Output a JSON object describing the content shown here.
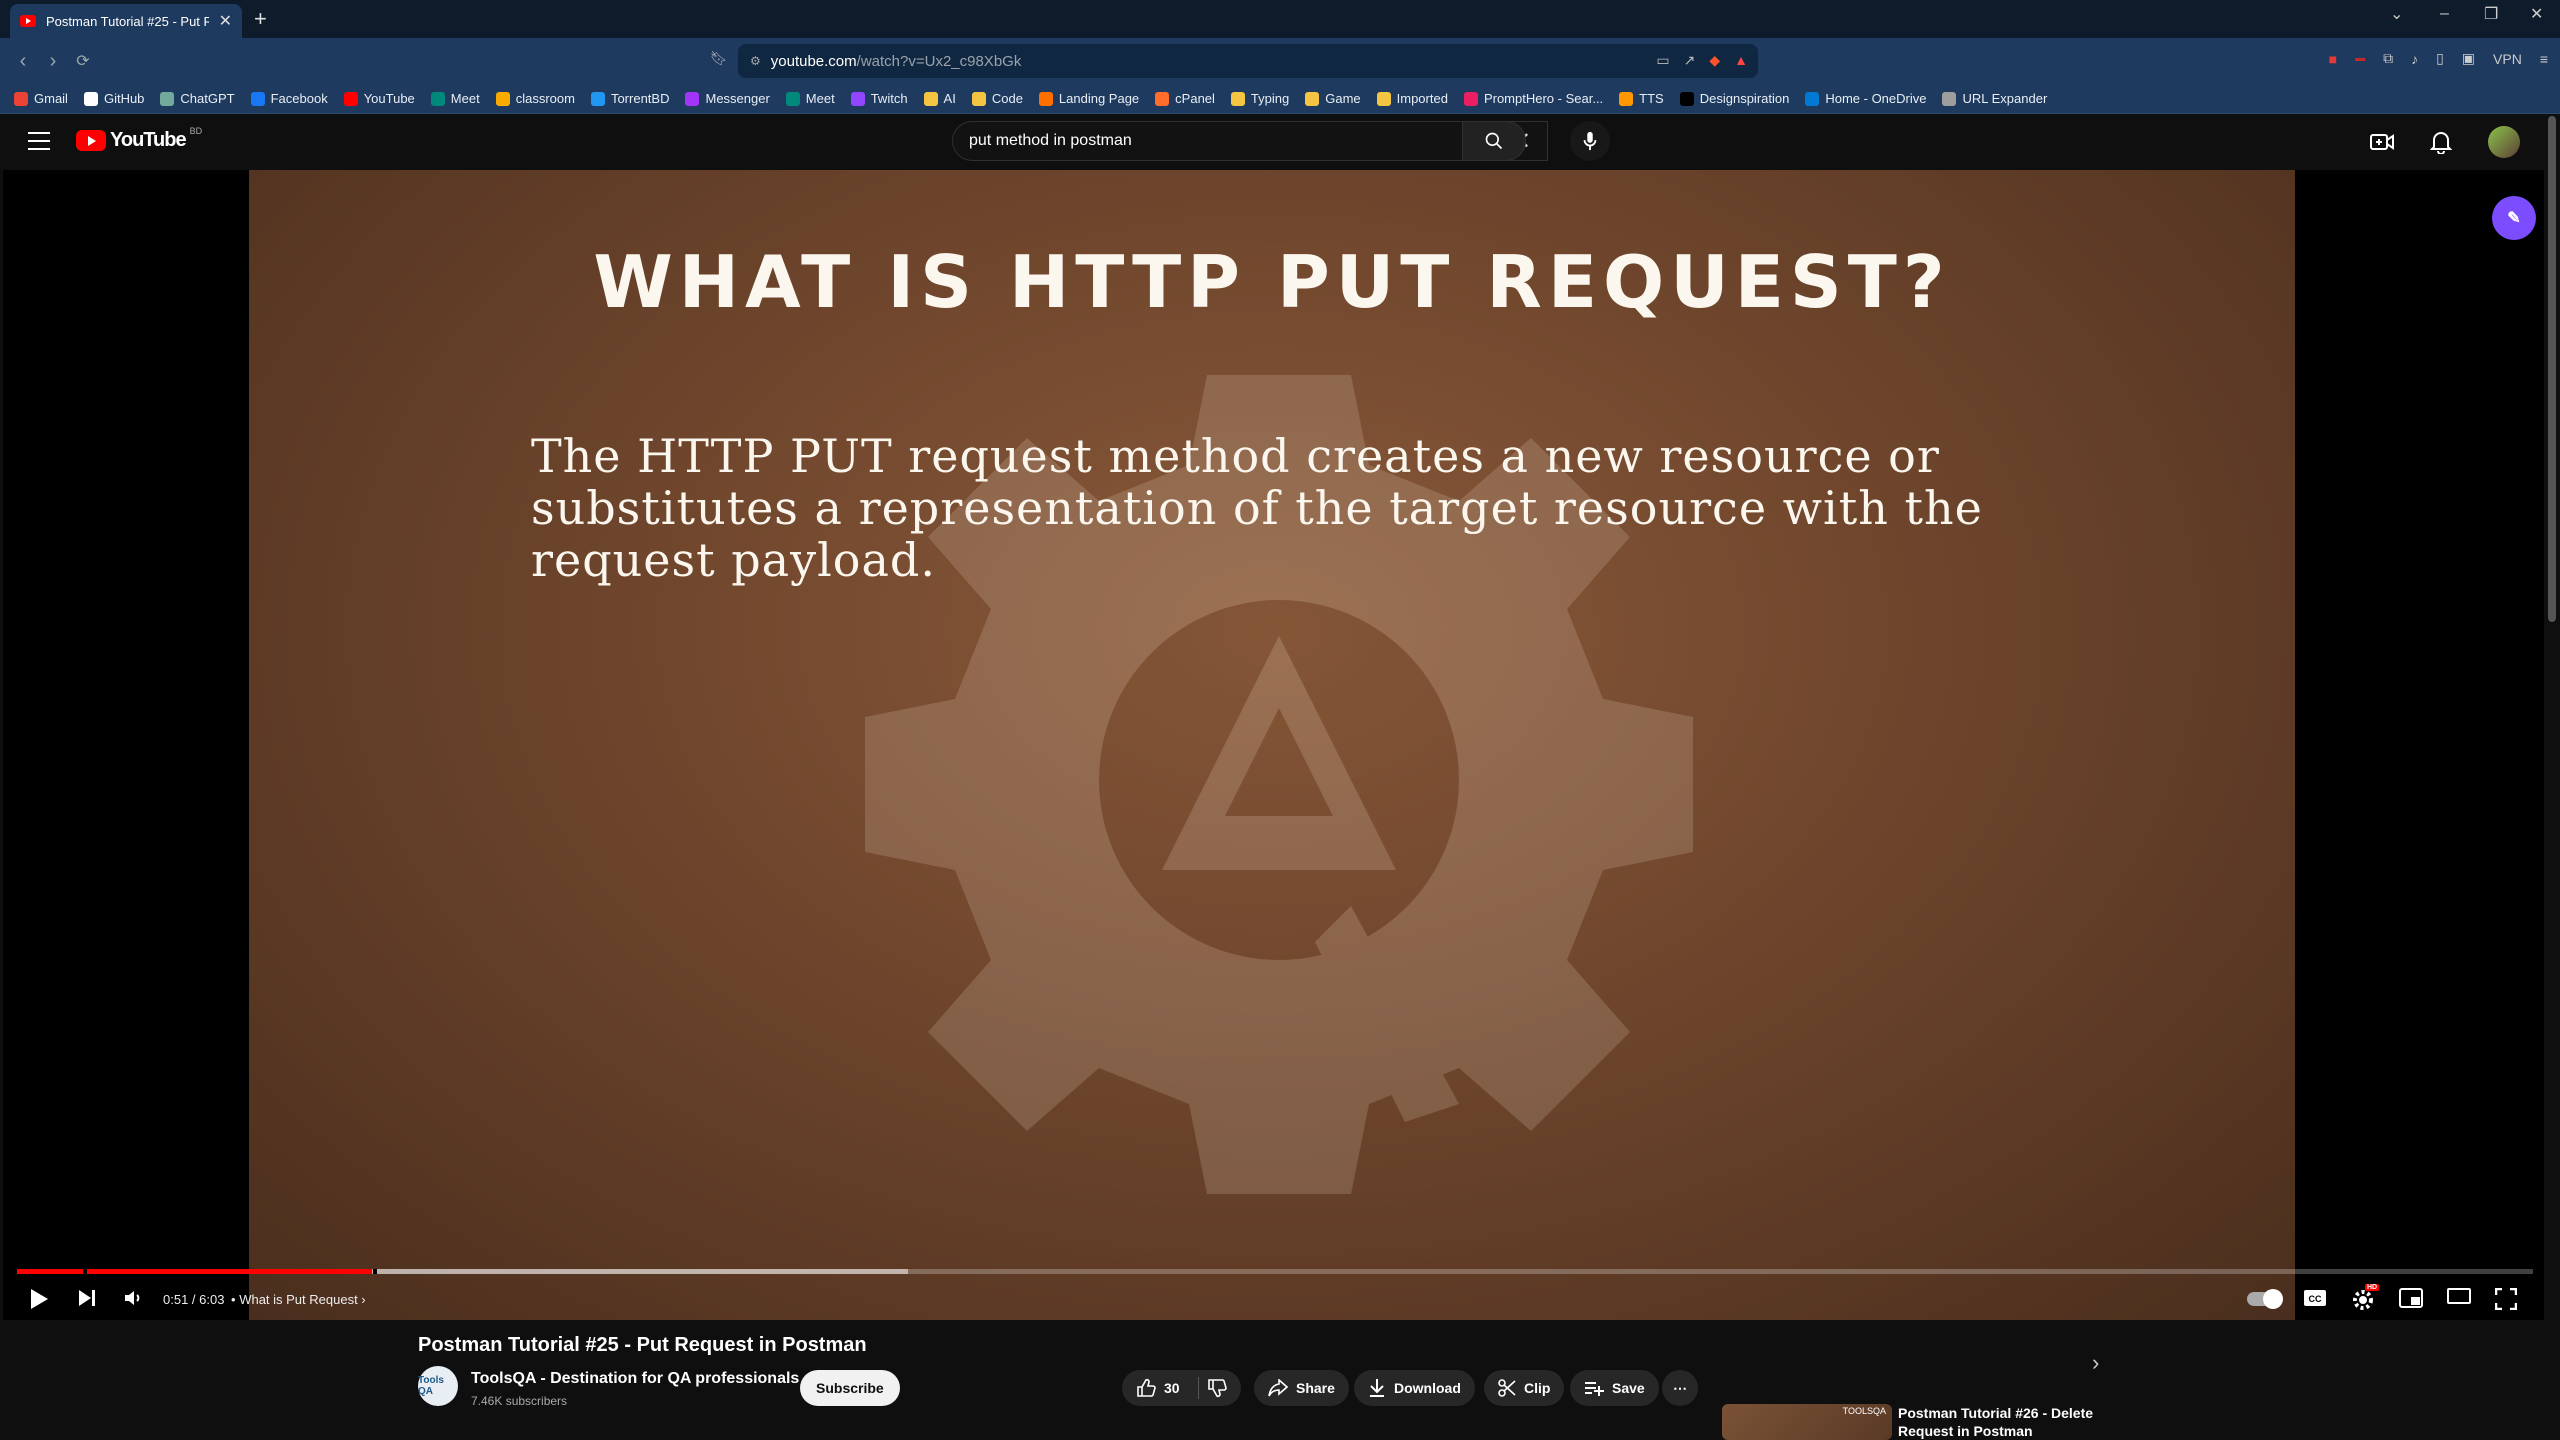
{
  "browser": {
    "tab_title": "Postman Tutorial #25 - Put Req...",
    "url_host": "youtube.com",
    "url_path": "/watch?v=Ux2_c98XbGk",
    "vpn_label": "VPN",
    "bookmarks": [
      {
        "label": "Gmail",
        "color": "#ea4335"
      },
      {
        "label": "GitHub",
        "color": "#ffffff"
      },
      {
        "label": "ChatGPT",
        "color": "#74aa9c"
      },
      {
        "label": "Facebook",
        "color": "#1877f2"
      },
      {
        "label": "YouTube",
        "color": "#ff0000"
      },
      {
        "label": "Meet",
        "color": "#00897b"
      },
      {
        "label": "classroom",
        "color": "#f9ab00"
      },
      {
        "label": "TorrentBD",
        "color": "#2196f3"
      },
      {
        "label": "Messenger",
        "color": "#a334fa"
      },
      {
        "label": "Meet",
        "color": "#00897b"
      },
      {
        "label": "Twitch",
        "color": "#9146ff"
      },
      {
        "label": "AI",
        "color": "#f4c542"
      },
      {
        "label": "Code",
        "color": "#f4c542"
      },
      {
        "label": "Landing Page",
        "color": "#ff6f00"
      },
      {
        "label": "cPanel",
        "color": "#ff6c2c"
      },
      {
        "label": "Typing",
        "color": "#f4c542"
      },
      {
        "label": "Game",
        "color": "#f4c542"
      },
      {
        "label": "Imported",
        "color": "#f4c542"
      },
      {
        "label": "PromptHero - Sear...",
        "color": "#e91e63"
      },
      {
        "label": "TTS",
        "color": "#ff9800"
      },
      {
        "label": "Designspiration",
        "color": "#000000"
      },
      {
        "label": "Home - OneDrive",
        "color": "#0078d4"
      },
      {
        "label": "URL Expander",
        "color": "#9e9e9e"
      }
    ]
  },
  "youtube": {
    "logo_text": "YouTube",
    "country_code": "BD",
    "search_value": "put method in postman"
  },
  "video": {
    "slide_title": "WHAT IS HTTP PUT REQUEST?",
    "slide_body": "The HTTP PUT request method creates a new resource or substitutes a representation of the target resource with the request payload.",
    "time": "0:51 / 6:03",
    "chapter_separator": "•",
    "chapter": "What is Put Request",
    "played_fraction": 0.141,
    "buffered_fraction": 0.354,
    "hd_badge": "HD"
  },
  "below": {
    "title": "Postman Tutorial #25 - Put Request in Postman",
    "channel_name": "ToolsQA - Destination for QA professionals",
    "subscribers": "7.46K subscribers",
    "channel_avatar_text": "Tools QA",
    "subscribe_label": "Subscribe",
    "like_count": "30",
    "share_label": "Share",
    "download_label": "Download",
    "clip_label": "Clip",
    "save_label": "Save",
    "next_video_title": "Postman Tutorial #26 - Delete Request in Postman",
    "next_thumb_text": "TOOLSQA"
  }
}
